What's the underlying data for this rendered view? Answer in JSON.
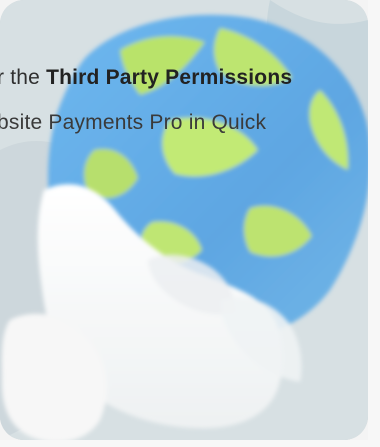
{
  "content": {
    "line1_prefix": "r the ",
    "line1_bold": "Third Party Permissions",
    "line2": "bsite Payments Pro in Quick"
  },
  "colors": {
    "background": "#f4f4f4",
    "globe_blue": "#67aeea",
    "globe_green": "#b9e36a",
    "hand_white": "#f7f7f7",
    "text": "#2f2f2f"
  },
  "icons": {
    "main_illustration": "globe-on-open-hands-icon"
  }
}
